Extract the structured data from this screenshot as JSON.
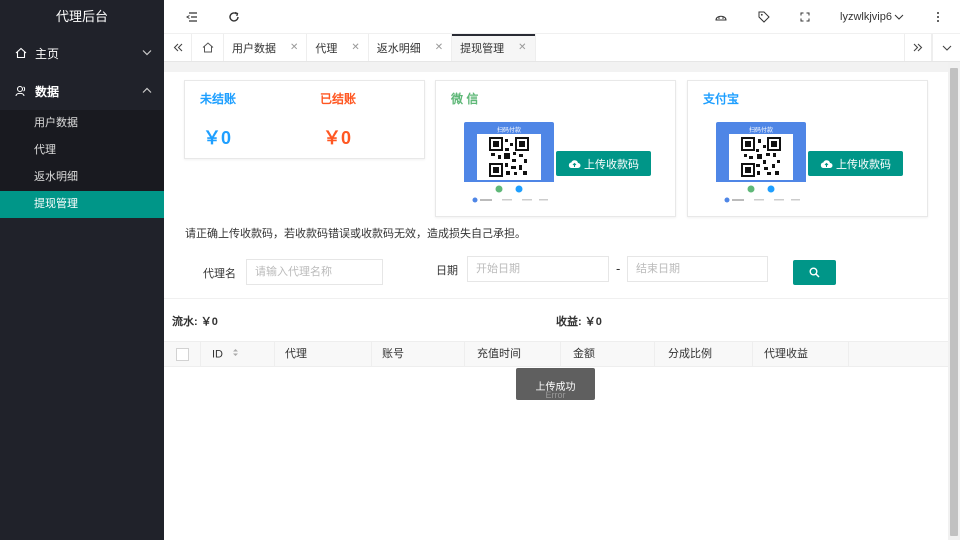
{
  "sidebar": {
    "title": "代理后台",
    "menu": [
      {
        "label": "主页",
        "icon": "home-icon"
      },
      {
        "label": "数据",
        "icon": "user-icon"
      }
    ],
    "submenu": [
      {
        "label": "用户数据"
      },
      {
        "label": "代理"
      },
      {
        "label": "返水明细"
      },
      {
        "label": "提现管理"
      }
    ],
    "active_item": "提现管理"
  },
  "header": {
    "username": "lyzwlkjvip6"
  },
  "tabs": [
    {
      "label": "用户数据"
    },
    {
      "label": "代理"
    },
    {
      "label": "返水明细"
    },
    {
      "label": "提现管理"
    }
  ],
  "stats": {
    "unsettled_label": "未结账",
    "unsettled_value": "￥0",
    "settled_label": "已结账",
    "settled_value": "￥0"
  },
  "wechat": {
    "label": "微 信",
    "qr_title": "扫码付款",
    "upload_label": "上传收款码"
  },
  "alipay": {
    "label": "支付宝",
    "qr_title": "扫码付款",
    "upload_label": "上传收款码"
  },
  "notice": "请正确上传收款码，若收款码错误或收款码无效，造成损失自己承担。",
  "filters": {
    "agent_label": "代理名",
    "agent_placeholder": "请输入代理名称",
    "date_label": "日期",
    "start_placeholder": "开始日期",
    "separator": "-",
    "end_placeholder": "结束日期"
  },
  "summary": {
    "flow": "流水: ￥0",
    "income": "收益: ￥0"
  },
  "table": {
    "columns": [
      "ID",
      "代理",
      "账号",
      "充值时间",
      "金额",
      "分成比例",
      "代理收益"
    ]
  },
  "toast": {
    "message": "上传成功",
    "sub": "Error"
  },
  "colors": {
    "sidebar_bg": "#20222a",
    "accent": "#009688",
    "unsettled": "#1e9fff",
    "settled": "#ff5722",
    "wechat": "#5fb878",
    "alipay": "#1e9fff"
  }
}
